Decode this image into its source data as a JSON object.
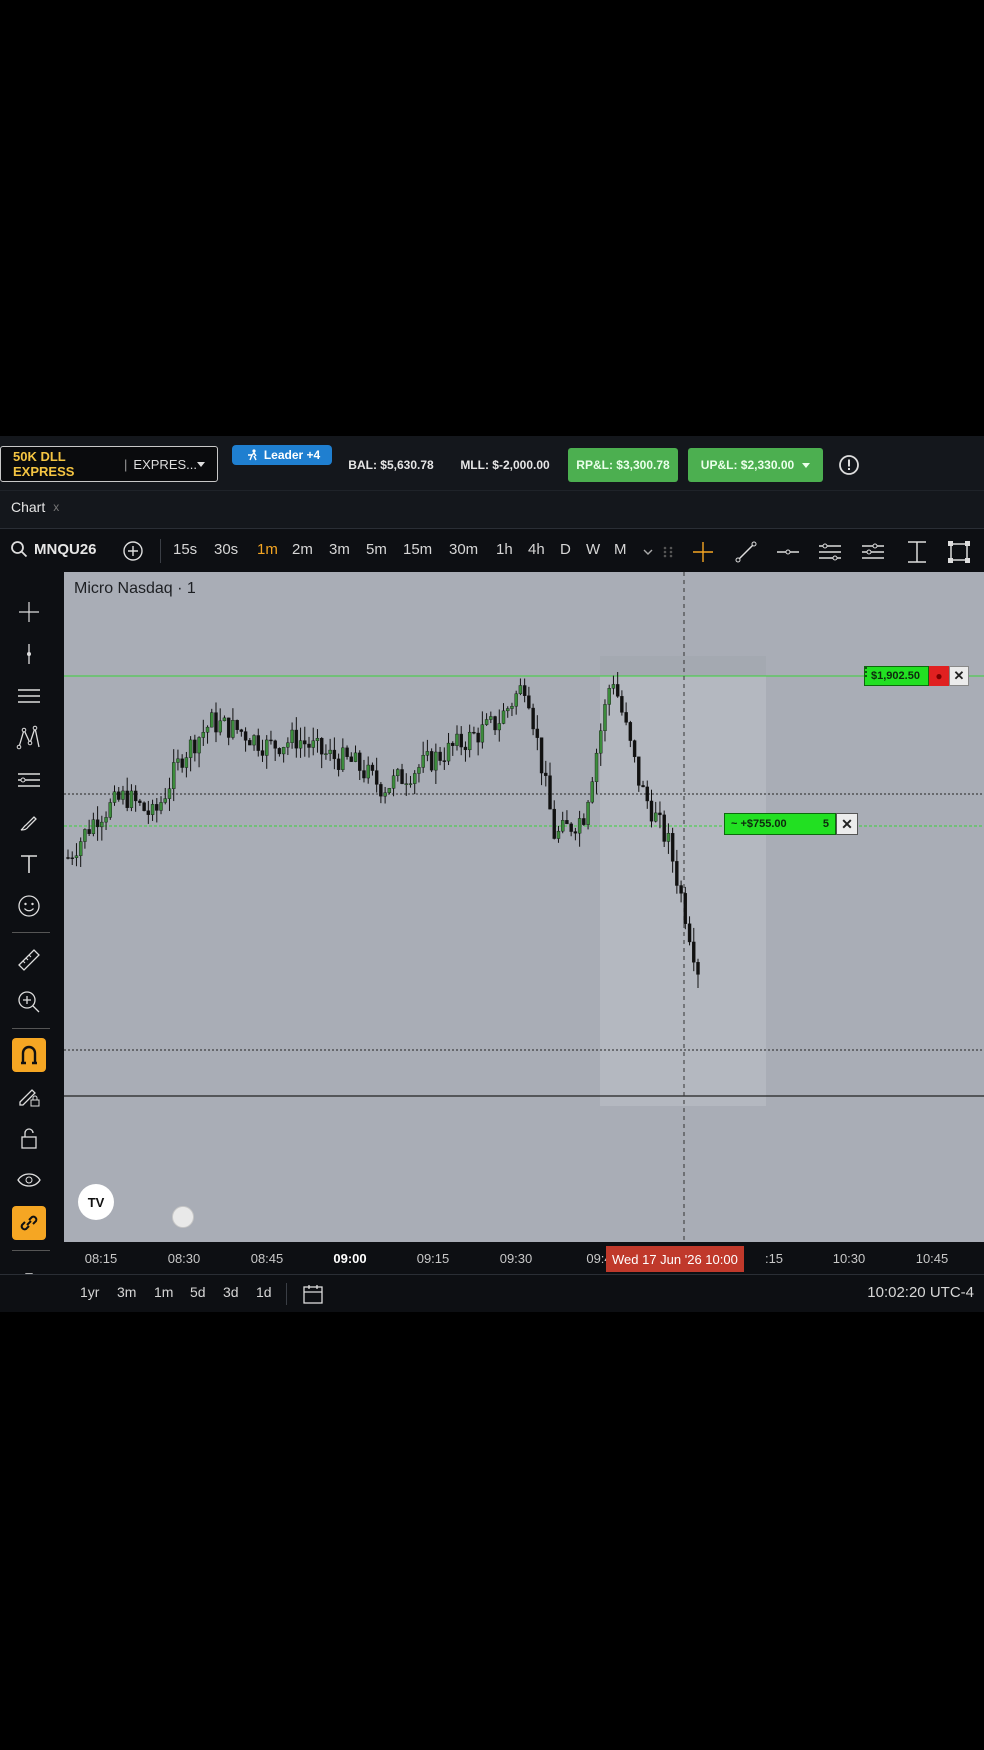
{
  "topbar": {
    "account_name": "50K DLL EXPRESS",
    "account_type": "EXPRES...",
    "leader_badge": "Leader +4",
    "balance": "BAL: $5,630.78",
    "mll": "MLL: $-2,000.00",
    "rpl": "RP&L: $3,300.78",
    "upl": "UP&L: $2,330.00",
    "accent_green": "#4caf50",
    "accent_blue": "#1f7fd0"
  },
  "tab": {
    "label": "Chart",
    "close": "x"
  },
  "toolbar": {
    "symbol": "MNQU26",
    "intervals": [
      "15s",
      "30s",
      "1m",
      "2m",
      "3m",
      "5m",
      "15m",
      "30m",
      "1h",
      "4h",
      "D",
      "W",
      "M"
    ],
    "active_interval": "1m",
    "icons": [
      "search-icon",
      "add-symbol-icon",
      "chevron-down-icon",
      "crosshair-icon",
      "trend-line-icon",
      "horizontal-line-icon",
      "horizontal-lines-icon",
      "indicators-icon",
      "vertical-range-icon",
      "fullscreen-icon"
    ]
  },
  "left_tools": [
    "crosshair-icon",
    "cursor-line-icon",
    "lines-icon",
    "pattern-icon",
    "fib-icon",
    "brush-icon",
    "text-icon",
    "emoji-icon",
    "ruler-icon",
    "zoom-in-icon",
    "magnet-icon",
    "lock-pencil-icon",
    "lock-icon",
    "eye-icon",
    "link-icon",
    "trash-icon"
  ],
  "chart": {
    "title": "Micro Nasdaq · 1",
    "order_label_1": {
      "price": "$1,902.50",
      "color": "#22e022"
    },
    "order_label_2": {
      "pnl": "~ +$755.00",
      "qty": "5"
    },
    "close_glyph": "✕",
    "cursor_time": "Wed 17 Jun '26  10:00",
    "time_ticks": [
      {
        "label": "08:15",
        "bold": false
      },
      {
        "label": "08:30",
        "bold": false
      },
      {
        "label": "08:45",
        "bold": false
      },
      {
        "label": "09:00",
        "bold": true
      },
      {
        "label": "09:15",
        "bold": false
      },
      {
        "label": "09:30",
        "bold": false
      },
      {
        "label": "09:4",
        "bold": false
      },
      {
        "label": ":15",
        "bold": false
      },
      {
        "label": "10:30",
        "bold": false
      },
      {
        "label": "10:45",
        "bold": false
      }
    ],
    "logo": "TV"
  },
  "chart_data": {
    "type": "candlestick",
    "title": "Micro Nasdaq · 1",
    "x": [
      "08:10",
      "08:15",
      "08:20",
      "08:25",
      "08:30",
      "08:35",
      "08:40",
      "08:45",
      "08:50",
      "08:55",
      "09:00",
      "09:05",
      "09:10",
      "09:15",
      "09:20",
      "09:25",
      "09:30",
      "09:35",
      "09:40",
      "09:45",
      "09:50",
      "09:55",
      "10:00"
    ],
    "close": [
      0.45,
      0.55,
      0.6,
      0.55,
      0.7,
      0.78,
      0.76,
      0.72,
      0.74,
      0.7,
      0.68,
      0.62,
      0.66,
      0.7,
      0.74,
      0.78,
      0.88,
      0.5,
      0.55,
      0.9,
      0.62,
      0.48,
      0.18
    ],
    "candle_colors": {
      "up": "#3c8c3c",
      "down": "#111111"
    },
    "price_lines": [
      "$1,902.50",
      "~ +$755.00"
    ]
  },
  "bottombar": {
    "ranges": [
      "1yr",
      "3m",
      "1m",
      "5d",
      "3d",
      "1d"
    ],
    "clock": "10:02:20 UTC-4"
  }
}
